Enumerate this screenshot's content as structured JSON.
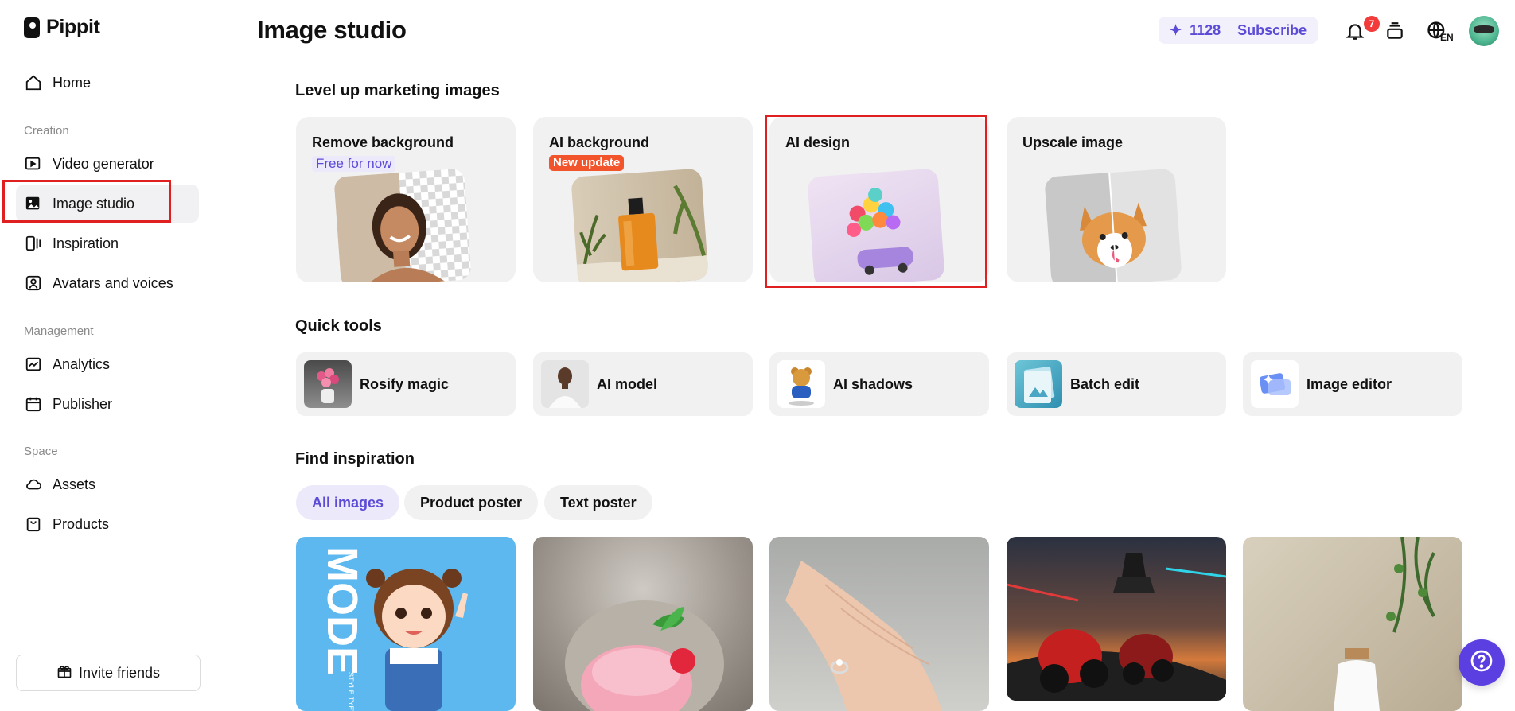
{
  "app": {
    "name": "Pippit"
  },
  "sidebar": {
    "items": [
      {
        "label": "Home",
        "icon": "home-icon"
      },
      {
        "label": "Video generator",
        "icon": "video-add-icon"
      },
      {
        "label": "Image studio",
        "icon": "image-add-icon"
      },
      {
        "label": "Inspiration",
        "icon": "inspiration-icon"
      },
      {
        "label": "Avatars and voices",
        "icon": "avatar-icon"
      },
      {
        "label": "Analytics",
        "icon": "analytics-icon"
      },
      {
        "label": "Publisher",
        "icon": "calendar-icon"
      },
      {
        "label": "Assets",
        "icon": "cloud-icon"
      },
      {
        "label": "Products",
        "icon": "bag-icon"
      }
    ],
    "sections": {
      "creation": "Creation",
      "management": "Management",
      "space": "Space"
    },
    "active": "Image studio",
    "invite_label": "Invite friends"
  },
  "header": {
    "title": "Image studio",
    "credits": "1128",
    "subscribe_label": "Subscribe",
    "notification_count": "7",
    "language": "EN"
  },
  "marketing": {
    "title": "Level up marketing images",
    "cards": [
      {
        "title": "Remove background",
        "tag": "Free for now"
      },
      {
        "title": "AI background",
        "tag": "New update"
      },
      {
        "title": "AI design",
        "tag": ""
      },
      {
        "title": "Upscale image",
        "tag": ""
      }
    ]
  },
  "quick_tools": {
    "title": "Quick tools",
    "items": [
      {
        "label": "Rosify magic"
      },
      {
        "label": "AI model"
      },
      {
        "label": "AI shadows"
      },
      {
        "label": "Batch edit"
      },
      {
        "label": "Image editor"
      }
    ]
  },
  "inspiration": {
    "title": "Find inspiration",
    "filters": [
      "All images",
      "Product poster",
      "Text poster"
    ],
    "active_filter": "All images",
    "poster_text": "MODE",
    "poster_subtext": "STYLE TYEW"
  },
  "colors": {
    "accent": "#5b4bd6",
    "highlight": "#e02020",
    "badge": "#f23b3b",
    "new_tag": "#f2552c"
  }
}
